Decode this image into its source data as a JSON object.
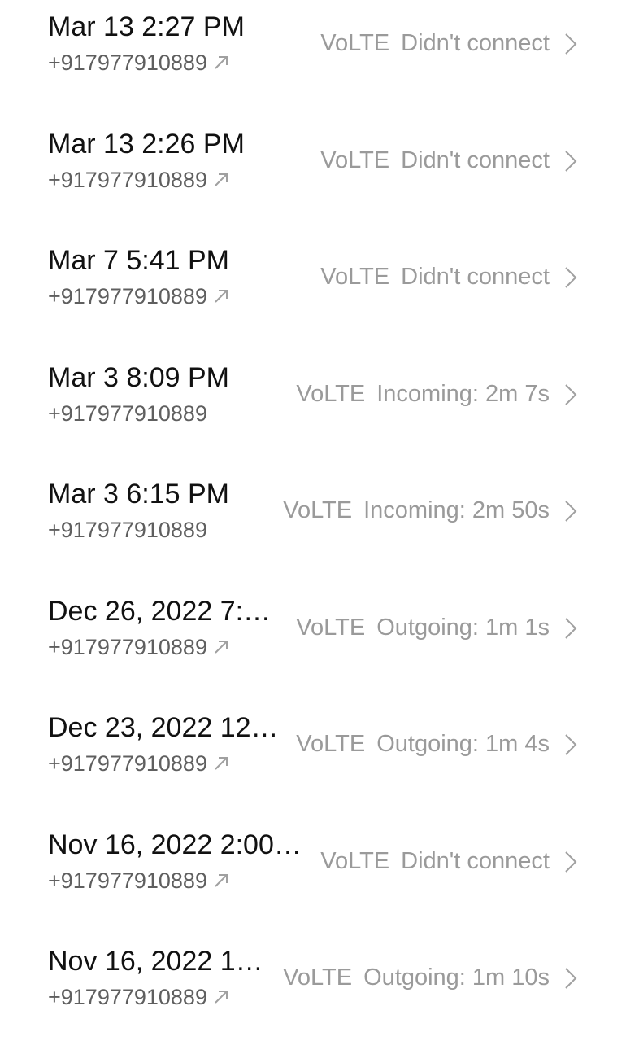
{
  "calls": [
    {
      "datetime": "Mar 13 2:27 PM",
      "number": "+917977910889",
      "network": "VoLTE",
      "status": "Didn't connect",
      "outgoing_icon": "arrow-up-right-icon"
    },
    {
      "datetime": "Mar 13 2:26 PM",
      "number": "+917977910889",
      "network": "VoLTE",
      "status": "Didn't connect",
      "outgoing_icon": "arrow-up-right-icon"
    },
    {
      "datetime": "Mar 7 5:41 PM",
      "number": "+917977910889",
      "network": "VoLTE",
      "status": "Didn't connect",
      "outgoing_icon": "arrow-up-right-icon"
    },
    {
      "datetime": "Mar 3 8:09 PM",
      "number": "+917977910889",
      "network": "VoLTE",
      "status": "Incoming: 2m 7s",
      "outgoing_icon": null
    },
    {
      "datetime": "Mar 3 6:15 PM",
      "number": "+917977910889",
      "network": "VoLTE",
      "status": "Incoming: 2m 50s",
      "outgoing_icon": null
    },
    {
      "datetime": "Dec 26, 2022 7:…",
      "number": "+917977910889",
      "network": "VoLTE",
      "status": "Outgoing: 1m 1s",
      "outgoing_icon": "arrow-up-right-icon"
    },
    {
      "datetime": "Dec 23, 2022 12…",
      "number": "+917977910889",
      "network": "VoLTE",
      "status": "Outgoing: 1m 4s",
      "outgoing_icon": "arrow-up-right-icon"
    },
    {
      "datetime": "Nov 16, 2022 2:00…",
      "number": "+917977910889",
      "network": "VoLTE",
      "status": "Didn't connect",
      "outgoing_icon": "arrow-up-right-icon"
    },
    {
      "datetime": "Nov 16, 2022 1…",
      "number": "+917977910889",
      "network": "VoLTE",
      "status": "Outgoing: 1m 10s",
      "outgoing_icon": "arrow-up-right-icon"
    }
  ],
  "colors": {
    "primary_text": "#111111",
    "secondary_text": "#5f5f5f",
    "meta_text": "#9a9a9a",
    "icon_gray": "#a0a0a0"
  }
}
